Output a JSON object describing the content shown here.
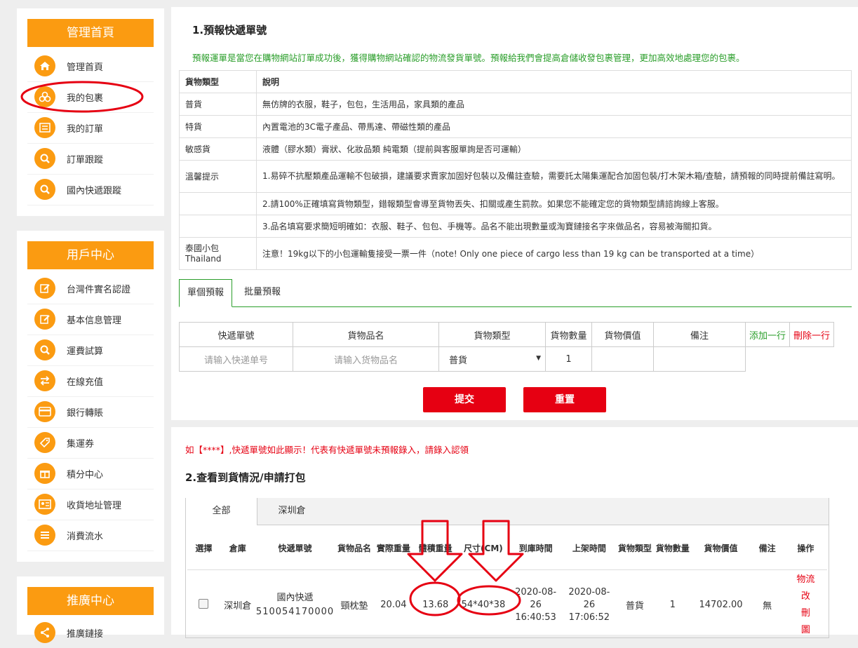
{
  "sidebar": {
    "admin": {
      "header": "管理首頁",
      "items": [
        {
          "icon": "home-icon",
          "label": "管理首頁"
        },
        {
          "icon": "packages-icon",
          "label": "我的包裹"
        },
        {
          "icon": "list-icon",
          "label": "我的訂單"
        },
        {
          "icon": "search-icon",
          "label": "訂單跟蹤"
        },
        {
          "icon": "search-icon",
          "label": "國內快遞跟蹤"
        }
      ]
    },
    "user": {
      "header": "用戶中心",
      "items": [
        {
          "icon": "edit-icon",
          "label": "台灣件實名認證"
        },
        {
          "icon": "edit-icon",
          "label": "基本信息管理"
        },
        {
          "icon": "search-icon",
          "label": "運費試算"
        },
        {
          "icon": "exchange-icon",
          "label": "在線充值"
        },
        {
          "icon": "card-icon",
          "label": "銀行轉賬"
        },
        {
          "icon": "coupon-icon",
          "label": "集運券"
        },
        {
          "icon": "gift-icon",
          "label": "積分中心"
        },
        {
          "icon": "address-card-icon",
          "label": "收貨地址管理"
        },
        {
          "icon": "list-icon",
          "label": "消費流水"
        }
      ]
    },
    "promo": {
      "header": "推廣中心",
      "items": [
        {
          "icon": "share-icon",
          "label": "推廣鏈接"
        }
      ]
    }
  },
  "prereport": {
    "title": "1.預報快遞單號",
    "intro": "預報運單是當您在購物網站訂單成功後，獲得購物網站確認的物流發貨單號。預報給我們會提高倉儲收發包裹管理，更加高效地處理您的包裹。",
    "cargo_table": {
      "headers": [
        "貨物類型",
        "說明"
      ],
      "rows": [
        [
          "普貨",
          "無仿牌的衣服，鞋子，包包，生活用品，家具類的產品"
        ],
        [
          "特貨",
          "內置電池的3C電子產品、帶馬達、帶磁性類的產品"
        ],
        [
          "敏感貨",
          "液體（膠水類）膏狀、化妝品類 純電類（提前與客服單詢是否可運輸）"
        ],
        [
          "溫馨提示",
          "1.易碎不抗壓類產品運輸不包破損，建議要求賣家加固好包裝以及備註查驗，需要託太陽集運配合加固包裝/打木架木箱/查驗，請預報的同時提前備註寫明。"
        ],
        [
          "",
          "2.請100%正確填寫貨物類型，錯報類型會導至貨物丟失、扣關或產生罰款。如果您不能確定您的貨物類型請諮詢線上客服。"
        ],
        [
          "",
          "3.品名填寫要求簡短明確如：衣服、鞋子、包包、手機等。品名不能出現數量或淘寶鏈接名字來做品名，容易被海關扣貨。"
        ],
        [
          "泰國小包\nThailand",
          "注意！19kg以下的小包運輸隻接受一票一件（note! Only one piece of cargo less than 19 kg can be transported at a time）"
        ]
      ]
    },
    "tabs": [
      "單個預報",
      "批量預報"
    ],
    "form": {
      "headers": [
        "快遞單號",
        "貨物品名",
        "貨物類型",
        "貨物數量",
        "貨物價值",
        "備注"
      ],
      "add_row": "添加一行",
      "delete_row": "刪除一行",
      "tracking_placeholder": "请输入快递单号",
      "name_placeholder": "请输入货物品名",
      "type_value": "普貨",
      "quantity_value": "1"
    },
    "submit": "提交",
    "reset": "重置"
  },
  "notice": "如【****】,快遞單號如此顯示！代表有快遞單號未預報錄入，請錄入認領",
  "arrival": {
    "title": "2.查看到貨情況/申請打包",
    "tabs": [
      "全部",
      "深圳倉"
    ],
    "headers": [
      "選擇",
      "倉庫",
      "快遞單號",
      "貨物品名",
      "實際重量",
      "體積重量",
      "尺寸(CM)",
      "到庫時間",
      "上架時間",
      "貨物類型",
      "貨物數量",
      "貨物價值",
      "備注",
      "操作"
    ],
    "row": {
      "warehouse": "深圳倉",
      "tracking": "國內快遞",
      "tracking_number": "510054170000",
      "name": "頸枕墊",
      "actual_weight": "20.04",
      "volume_weight": "13.68",
      "size": "54*40*38",
      "arrival_date": "2020-08-26",
      "arrival_time": "16:40:53",
      "shelf_date": "2020-08-26",
      "shelf_time": "17:06:52",
      "cargo_type": "普貨",
      "quantity": "1",
      "value": "14702.00",
      "remark": "無",
      "ops": [
        "物流",
        "改",
        "刪",
        "圖"
      ]
    }
  },
  "colors": {
    "accent": "#fb9b11",
    "danger": "#e60012",
    "success": "#2a9e2a",
    "annotation": "#e60012"
  }
}
